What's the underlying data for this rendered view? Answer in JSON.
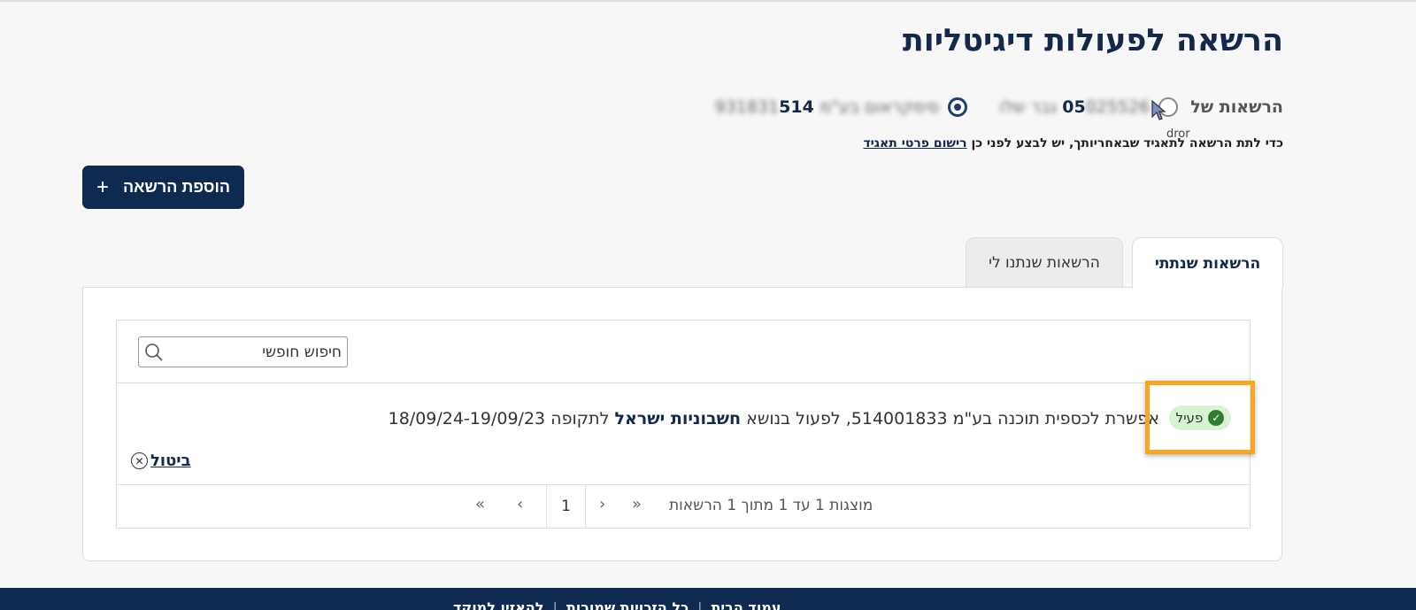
{
  "page": {
    "title": "הרשאה לפעולות דיגיטליות"
  },
  "permissions_of": {
    "label": "הרשאות של",
    "person_id_suffix": "05",
    "person_blurred": "025526 גבר שלו",
    "company_name_blurred": "סימקראום בע\"מ",
    "company_id_prefix": "514",
    "company_id_blurred": "931831",
    "cursor_tooltip": "dror"
  },
  "notice": {
    "text": "כדי לתת הרשאה לתאגיד שבאחריותך, יש לבצע לפני כן",
    "link": "רישום פרטי תאגיד"
  },
  "add_button": {
    "label": "הוספת הרשאה",
    "icon": "+"
  },
  "tabs": [
    {
      "label": "הרשאות שנתתי",
      "active": true
    },
    {
      "label": "הרשאות שנתנו לי",
      "active": false
    }
  ],
  "search": {
    "placeholder": "חיפוש חופשי"
  },
  "rows": [
    {
      "status": "פעיל",
      "text_before": "אפשרת לכספית תוכנה בע\"מ 514001833, לפעול בנושא",
      "text_bold": "חשבוניות ישראל",
      "text_after": "לתקופה 18/09/24-19/09/23",
      "cancel_label": "ביטול"
    }
  ],
  "pagination": {
    "summary": "מוצגות 1 עד 1 מתוך 1 הרשאות",
    "current_page": "1",
    "first": "«",
    "prev": "‹",
    "next": "›",
    "last": "»"
  },
  "footer": {
    "links": [
      "עמוד הבית",
      "כל הזכויות שמורות",
      "להאזין למוקד"
    ]
  },
  "colors": {
    "primary": "#0f2a51",
    "highlight": "#f5a623",
    "status_bg": "#d9f2d4",
    "status_check": "#2e7d32"
  }
}
